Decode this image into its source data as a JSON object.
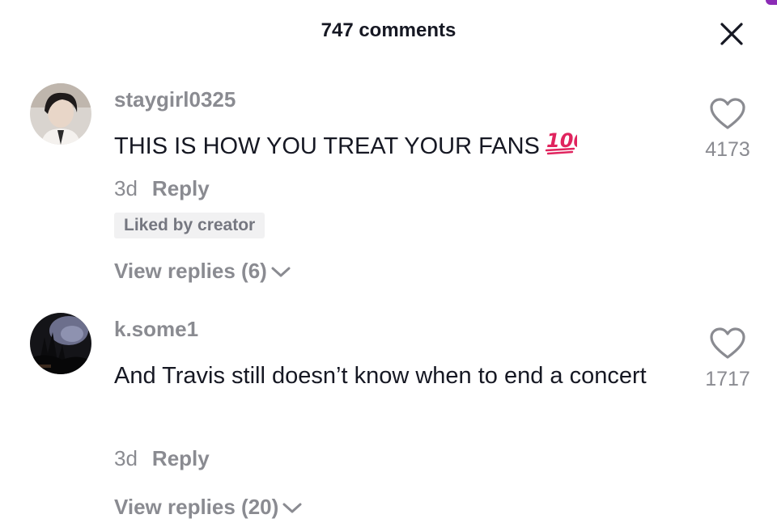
{
  "header": {
    "title": "747 comments"
  },
  "comments": [
    {
      "username": "staygirl0325",
      "text": "THIS IS HOW YOU TREAT YOUR FANS",
      "text_emoji": "100-emoji",
      "age": "3d",
      "reply_label": "Reply",
      "badge": "Liked by creator",
      "view_replies": "View replies (6)",
      "likes": "4173"
    },
    {
      "username": "k.some1",
      "text": "And Travis still doesn’t know when to end a concert",
      "age": "3d",
      "reply_label": "Reply",
      "view_replies": "View replies (20)",
      "likes": "1717"
    }
  ],
  "colors": {
    "text_primary": "#161823",
    "text_secondary": "#8a8b91",
    "badge_bg": "#f1f1f2",
    "emoji_red": "#e0245e",
    "accent": "#8b2bb5"
  },
  "icons": {
    "close": "close-icon",
    "like": "heart-outline-icon",
    "expand": "chevron-down-icon"
  }
}
